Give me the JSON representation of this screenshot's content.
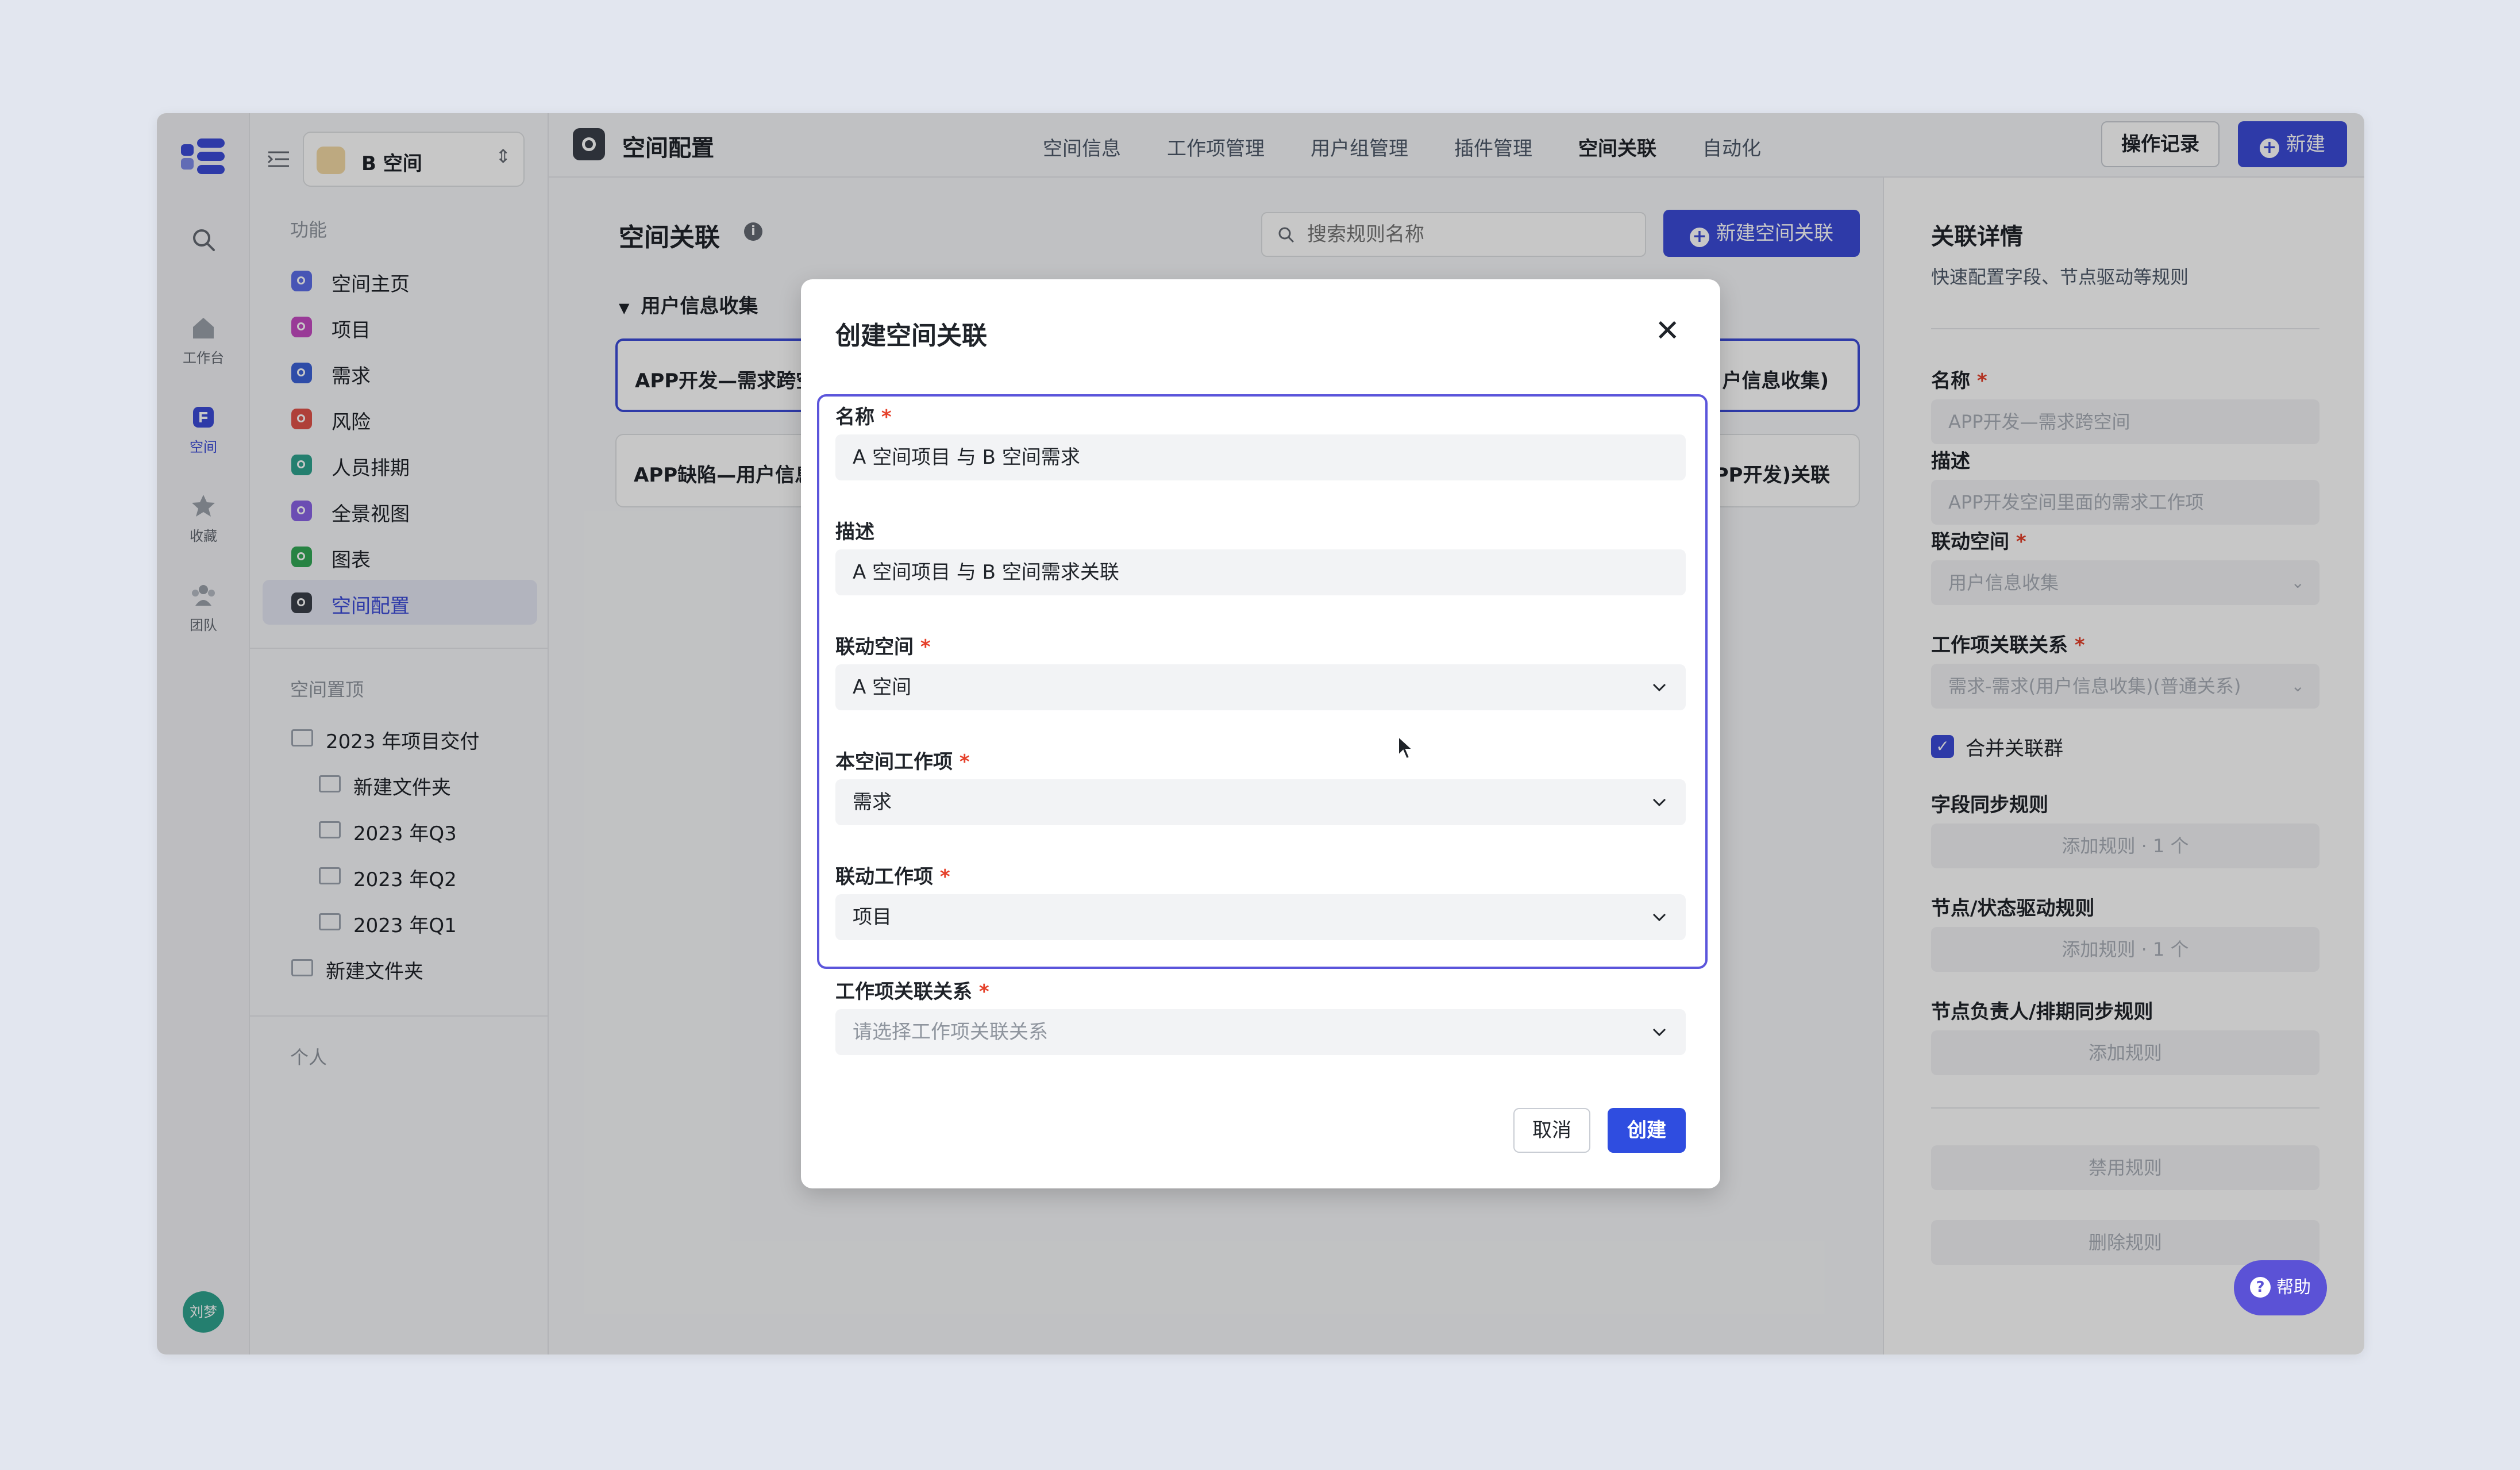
{
  "rail": {
    "items": [
      {
        "icon": "search-icon",
        "label": ""
      },
      {
        "icon": "home-icon",
        "label": "工作台"
      },
      {
        "icon": "space-icon",
        "label": "空间"
      },
      {
        "icon": "star-icon",
        "label": "收藏"
      },
      {
        "icon": "team-icon",
        "label": "团队"
      }
    ],
    "avatar": "刘梦"
  },
  "sidebar": {
    "space_name": "B 空间",
    "functions_header": "功能",
    "items": [
      {
        "label": "空间主页",
        "color": "#5b6ee8"
      },
      {
        "label": "项目",
        "color": "#c44bc2"
      },
      {
        "label": "需求",
        "color": "#3b62d8"
      },
      {
        "label": "风险",
        "color": "#e0524a"
      },
      {
        "label": "人员排期",
        "color": "#2fa38f"
      },
      {
        "label": "全景视图",
        "color": "#8a63e6"
      },
      {
        "label": "图表",
        "color": "#33a856"
      },
      {
        "label": "空间配置",
        "color": "#3a3f4a"
      }
    ],
    "pinned_header": "空间置顶",
    "tree": [
      {
        "label": "2023 年项目交付",
        "level": 0
      },
      {
        "label": "新建文件夹",
        "level": 1
      },
      {
        "label": "2023 年Q3",
        "level": 1
      },
      {
        "label": "2023 年Q2",
        "level": 1
      },
      {
        "label": "2023 年Q1",
        "level": 1
      },
      {
        "label": "新建文件夹",
        "level": 0
      }
    ],
    "personal_header": "个人"
  },
  "topbar": {
    "title": "空间配置",
    "tabs": [
      "空间信息",
      "工作项管理",
      "用户组管理",
      "插件管理",
      "空间关联",
      "自动化"
    ],
    "active_tab": "空间关联",
    "history_button": "操作记录",
    "new_button": "新建"
  },
  "main": {
    "title": "空间关联",
    "search_placeholder": "搜索规则名称",
    "new_relation_button": "新建空间关联",
    "group_label": "用户信息收集",
    "rules": [
      {
        "left": "APP开发—需求跨空",
        "right": "户信息收集)"
      },
      {
        "left": "APP缺陷—用户信息",
        "right": "PP开发)关联"
      }
    ]
  },
  "detail": {
    "title": "关联详情",
    "subtitle": "快速配置字段、节点驱动等规则",
    "name_label": "名称",
    "name_value": "APP开发—需求跨空间",
    "desc_label": "描述",
    "desc_value": "APP开发空间里面的需求工作项",
    "linked_space_label": "联动空间",
    "linked_space_value": "用户信息收集",
    "relation_label": "工作项关联关系",
    "relation_value": "需求-需求(用户信息收集)(普通关系)",
    "merge_label": "合并关联群",
    "field_sync_label": "字段同步规则",
    "field_sync_value": "添加规则 · 1 个",
    "node_rule_label": "节点/状态驱动规则",
    "node_rule_value": "添加规则 · 1 个",
    "owner_rule_label": "节点负责人/排期同步规则",
    "owner_rule_value": "添加规则",
    "disable_button": "禁用规则",
    "delete_button": "删除规则"
  },
  "help_button": "帮助",
  "modal": {
    "title": "创建空间关联",
    "name_label": "名称",
    "name_value": "A 空间项目 与 B 空间需求",
    "desc_label": "描述",
    "desc_value": "A 空间项目 与 B 空间需求关联",
    "linked_space_label": "联动空间",
    "linked_space_value": "A 空间",
    "this_item_label": "本空间工作项",
    "this_item_value": "需求",
    "linked_item_label": "联动工作项",
    "linked_item_value": "项目",
    "relation_label": "工作项关联关系",
    "relation_placeholder": "请选择工作项关联关系",
    "cancel_button": "取消",
    "create_button": "创建"
  }
}
